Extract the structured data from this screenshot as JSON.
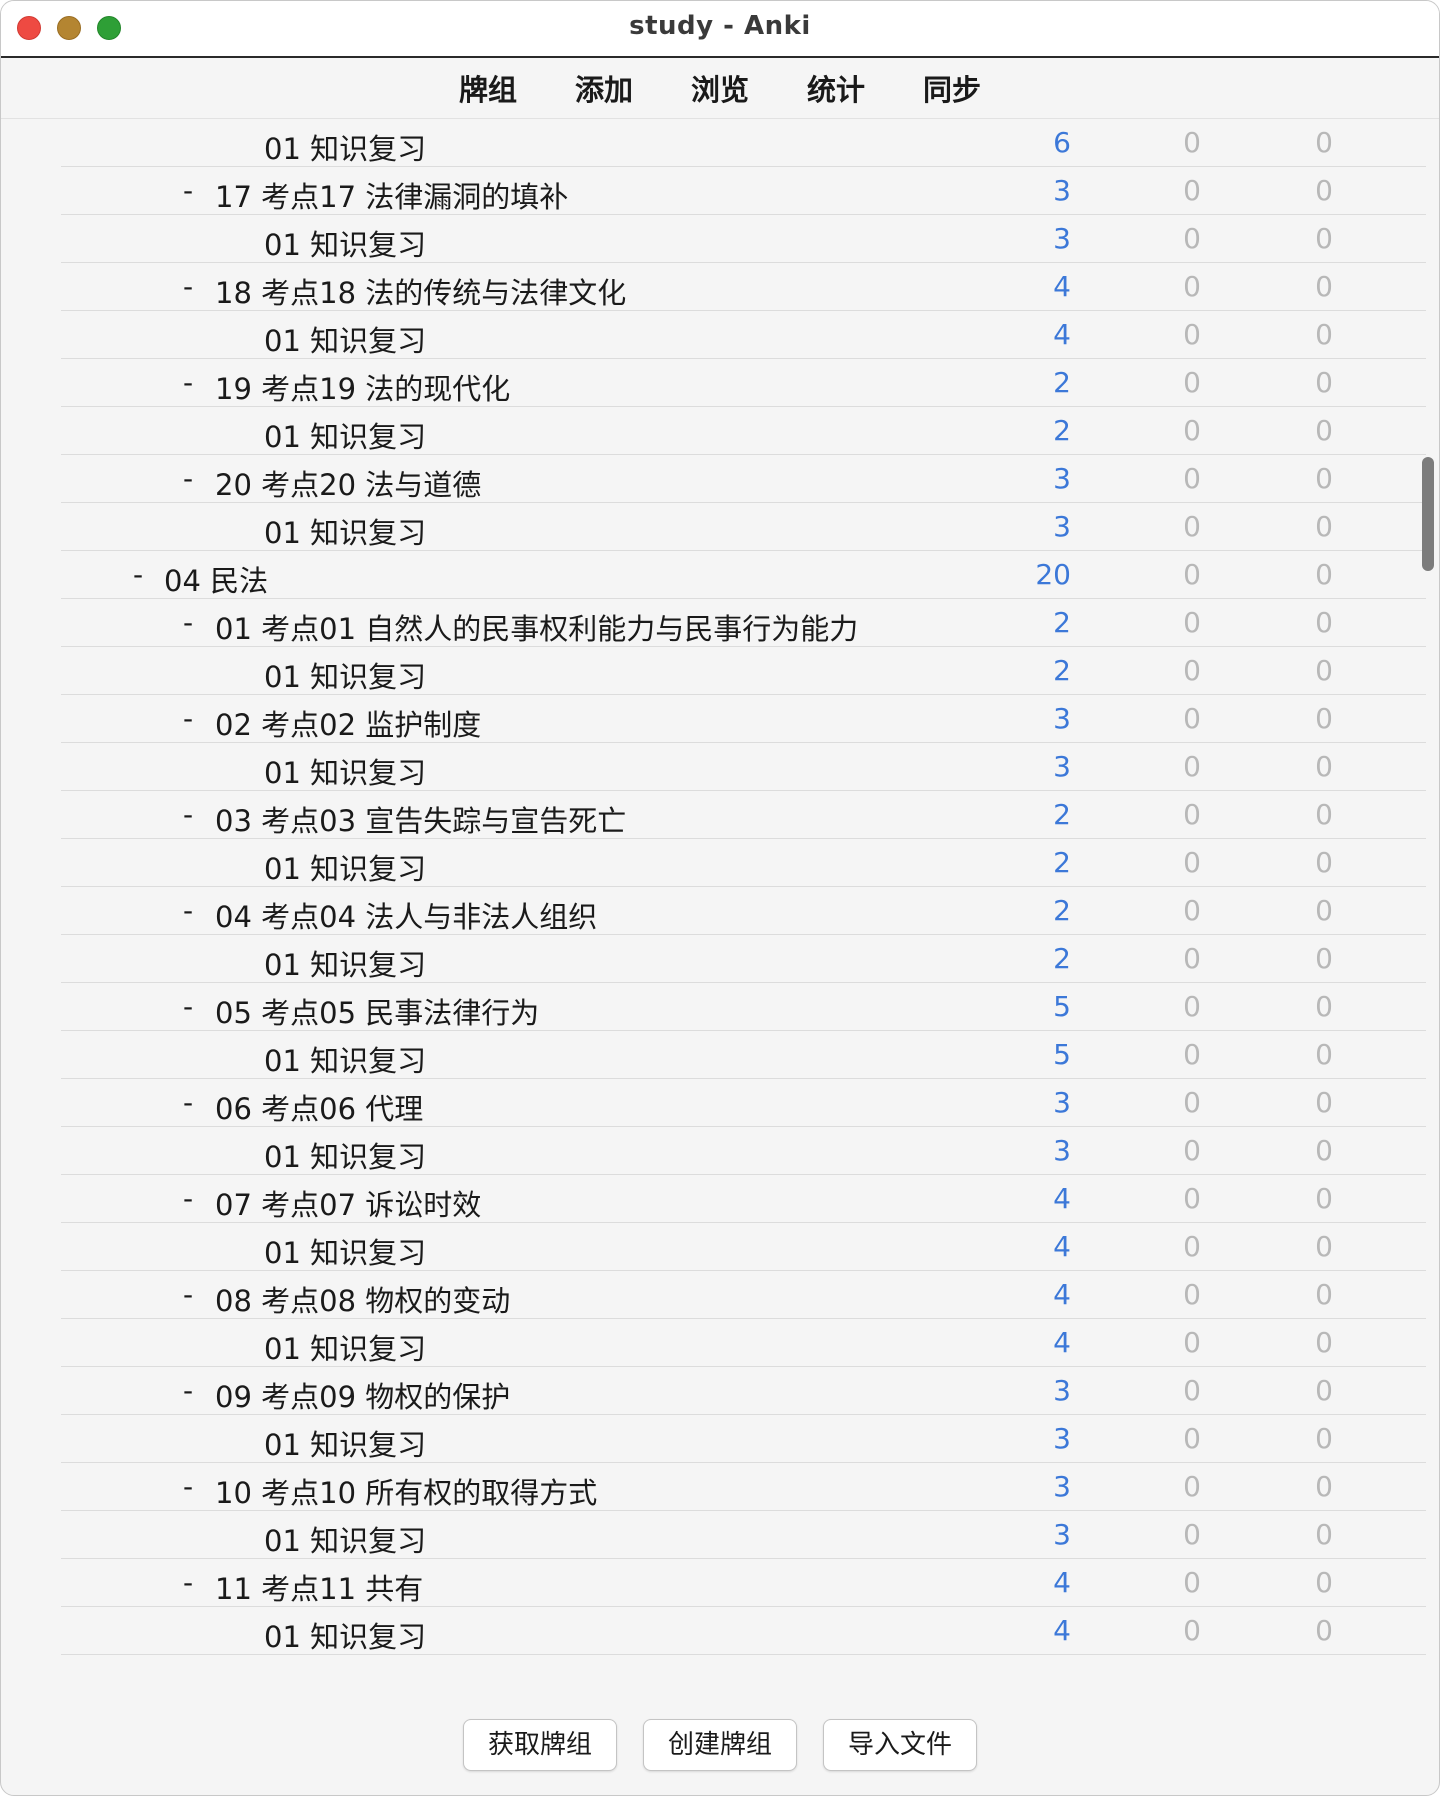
{
  "window": {
    "title": "study - Anki",
    "controls": [
      "close-button",
      "minimize-button",
      "maximize-button"
    ]
  },
  "toolbar": {
    "links": [
      "牌组",
      "添加",
      "浏览",
      "统计",
      "同步"
    ]
  },
  "deck_rows": [
    {
      "level": 3,
      "collapse": "",
      "name": "01 知识复习",
      "new": "6",
      "learn": "0",
      "review": "0"
    },
    {
      "level": 2,
      "collapse": "-",
      "name": "17 考点17 法律漏洞的填补",
      "new": "3",
      "learn": "0",
      "review": "0"
    },
    {
      "level": 3,
      "collapse": "",
      "name": "01 知识复习",
      "new": "3",
      "learn": "0",
      "review": "0"
    },
    {
      "level": 2,
      "collapse": "-",
      "name": "18 考点18 法的传统与法律文化",
      "new": "4",
      "learn": "0",
      "review": "0"
    },
    {
      "level": 3,
      "collapse": "",
      "name": "01 知识复习",
      "new": "4",
      "learn": "0",
      "review": "0"
    },
    {
      "level": 2,
      "collapse": "-",
      "name": "19 考点19 法的现代化",
      "new": "2",
      "learn": "0",
      "review": "0"
    },
    {
      "level": 3,
      "collapse": "",
      "name": "01 知识复习",
      "new": "2",
      "learn": "0",
      "review": "0"
    },
    {
      "level": 2,
      "collapse": "-",
      "name": "20 考点20 法与道德",
      "new": "3",
      "learn": "0",
      "review": "0"
    },
    {
      "level": 3,
      "collapse": "",
      "name": "01 知识复习",
      "new": "3",
      "learn": "0",
      "review": "0"
    },
    {
      "level": 1,
      "collapse": "-",
      "name": "04 民法",
      "new": "20",
      "learn": "0",
      "review": "0"
    },
    {
      "level": 2,
      "collapse": "-",
      "name": "01 考点01 自然人的民事权利能力与民事行为能力",
      "new": "2",
      "learn": "0",
      "review": "0"
    },
    {
      "level": 3,
      "collapse": "",
      "name": "01 知识复习",
      "new": "2",
      "learn": "0",
      "review": "0"
    },
    {
      "level": 2,
      "collapse": "-",
      "name": "02 考点02 监护制度",
      "new": "3",
      "learn": "0",
      "review": "0"
    },
    {
      "level": 3,
      "collapse": "",
      "name": "01 知识复习",
      "new": "3",
      "learn": "0",
      "review": "0"
    },
    {
      "level": 2,
      "collapse": "-",
      "name": "03 考点03 宣告失踪与宣告死亡",
      "new": "2",
      "learn": "0",
      "review": "0"
    },
    {
      "level": 3,
      "collapse": "",
      "name": "01 知识复习",
      "new": "2",
      "learn": "0",
      "review": "0"
    },
    {
      "level": 2,
      "collapse": "-",
      "name": "04 考点04 法人与非法人组织",
      "new": "2",
      "learn": "0",
      "review": "0"
    },
    {
      "level": 3,
      "collapse": "",
      "name": "01 知识复习",
      "new": "2",
      "learn": "0",
      "review": "0"
    },
    {
      "level": 2,
      "collapse": "-",
      "name": "05 考点05 民事法律行为",
      "new": "5",
      "learn": "0",
      "review": "0"
    },
    {
      "level": 3,
      "collapse": "",
      "name": "01 知识复习",
      "new": "5",
      "learn": "0",
      "review": "0"
    },
    {
      "level": 2,
      "collapse": "-",
      "name": "06 考点06 代理",
      "new": "3",
      "learn": "0",
      "review": "0"
    },
    {
      "level": 3,
      "collapse": "",
      "name": "01 知识复习",
      "new": "3",
      "learn": "0",
      "review": "0"
    },
    {
      "level": 2,
      "collapse": "-",
      "name": "07 考点07 诉讼时效",
      "new": "4",
      "learn": "0",
      "review": "0"
    },
    {
      "level": 3,
      "collapse": "",
      "name": "01 知识复习",
      "new": "4",
      "learn": "0",
      "review": "0"
    },
    {
      "level": 2,
      "collapse": "-",
      "name": "08 考点08 物权的变动",
      "new": "4",
      "learn": "0",
      "review": "0"
    },
    {
      "level": 3,
      "collapse": "",
      "name": "01 知识复习",
      "new": "4",
      "learn": "0",
      "review": "0"
    },
    {
      "level": 2,
      "collapse": "-",
      "name": "09 考点09 物权的保护",
      "new": "3",
      "learn": "0",
      "review": "0"
    },
    {
      "level": 3,
      "collapse": "",
      "name": "01 知识复习",
      "new": "3",
      "learn": "0",
      "review": "0"
    },
    {
      "level": 2,
      "collapse": "-",
      "name": "10 考点10 所有权的取得方式",
      "new": "3",
      "learn": "0",
      "review": "0"
    },
    {
      "level": 3,
      "collapse": "",
      "name": "01 知识复习",
      "new": "3",
      "learn": "0",
      "review": "0"
    },
    {
      "level": 2,
      "collapse": "-",
      "name": "11 考点11 共有",
      "new": "4",
      "learn": "0",
      "review": "0"
    },
    {
      "level": 3,
      "collapse": "",
      "name": "01 知识复习",
      "new": "4",
      "learn": "0",
      "review": "0"
    }
  ],
  "bottom_buttons": {
    "get_shared": "获取牌组",
    "create_deck": "创建牌组",
    "import_file": "导入文件"
  },
  "colors": {
    "new_count": "#3c78d8",
    "zero_count": "#b8b8b8",
    "close": "#ee4a42",
    "minimize": "#b48531",
    "maximize": "#2e9f36"
  }
}
